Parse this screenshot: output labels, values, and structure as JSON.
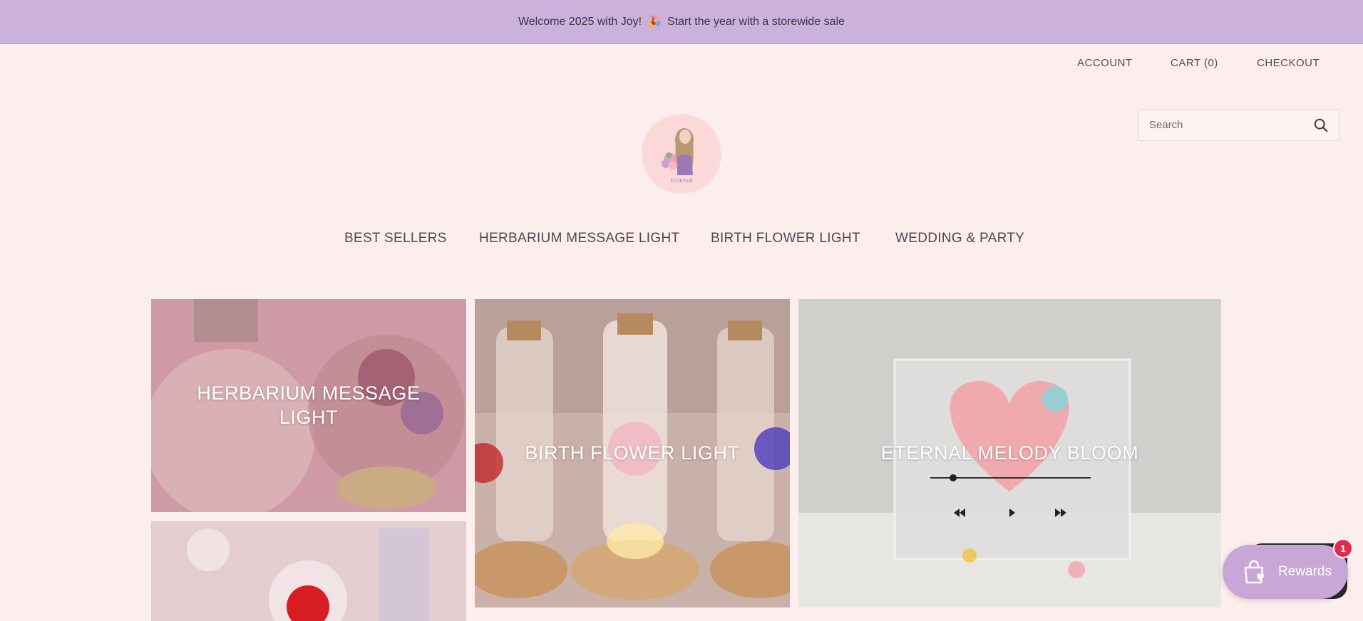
{
  "announcement": {
    "text_before": "Welcome 2025 with Joy!",
    "emoji": "🎉",
    "text_after": "Start the year with a storewide sale"
  },
  "header": {
    "account_label": "ACCOUNT",
    "cart_label": "CART (0)",
    "checkout_label": "CHECKOUT",
    "search_placeholder": "Search",
    "logo_text": "FLORYER"
  },
  "main_nav": {
    "items": [
      {
        "label": "BEST SELLERS"
      },
      {
        "label": "HERBARIUM MESSAGE LIGHT"
      },
      {
        "label": "BIRTH FLOWER LIGHT"
      },
      {
        "label": "WEDDING & PARTY"
      }
    ]
  },
  "collections": [
    {
      "label": "HERBARIUM MESSAGE LIGHT"
    },
    {
      "label": "BIRTH FLOWER LIGHT"
    },
    {
      "label": "ETERNAL MELODY BLOOM"
    },
    {
      "label": ""
    }
  ],
  "rewards": {
    "label": "Rewards",
    "badge_count": "1"
  },
  "colors": {
    "announcement_bg": "#ccb1dc",
    "page_bg": "#fdeeee",
    "rewards_bg": "#c8a7d6",
    "badge_bg": "#e02b4a"
  }
}
